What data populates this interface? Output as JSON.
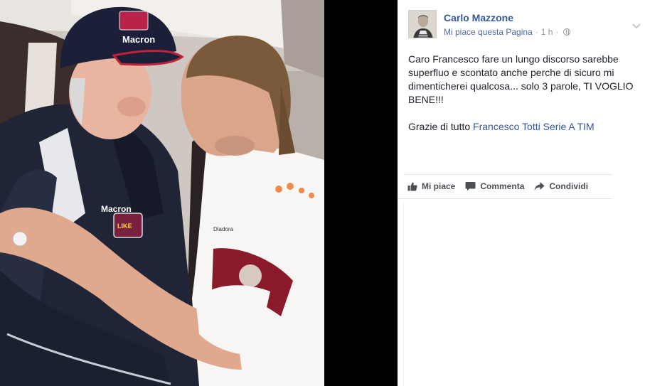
{
  "photo": {
    "cap_brand": "Macron",
    "jacket_brand": "Macron",
    "jacket_badge_text": "LIKE",
    "shirt_brand": "Diadora"
  },
  "post": {
    "page_name": "Carlo Mazzone",
    "like_page_link": "Mi piace questa Pagina",
    "separator": "·",
    "time": "1 h",
    "time_separator": "·",
    "body_line1": "Caro Francesco fare un lungo discorso sarebbe superfluo e scontato anche perche di sicuro mi dimenticherei qualcosa... solo 3 parole, TI VOGLIO BENE!!!",
    "body_line2_prefix": "Grazie di tutto ",
    "tag_totti": "Francesco Totti",
    "tag_seriea": "Serie A TIM"
  },
  "actions": {
    "like": "Mi piace",
    "comment": "Commenta",
    "share": "Condividi"
  },
  "colors": {
    "link_blue": "#365899",
    "text": "#1d2129",
    "meta_grey": "#90949c",
    "action_grey": "#4b4f56",
    "jacket_navy": "#1f2436",
    "armband_red": "#8b1a2b"
  },
  "icons": {
    "privacy": "globe-icon",
    "options": "chevron-down-icon",
    "like": "thumbs-up-icon",
    "comment": "speech-bubble-icon",
    "share": "share-arrow-icon"
  }
}
